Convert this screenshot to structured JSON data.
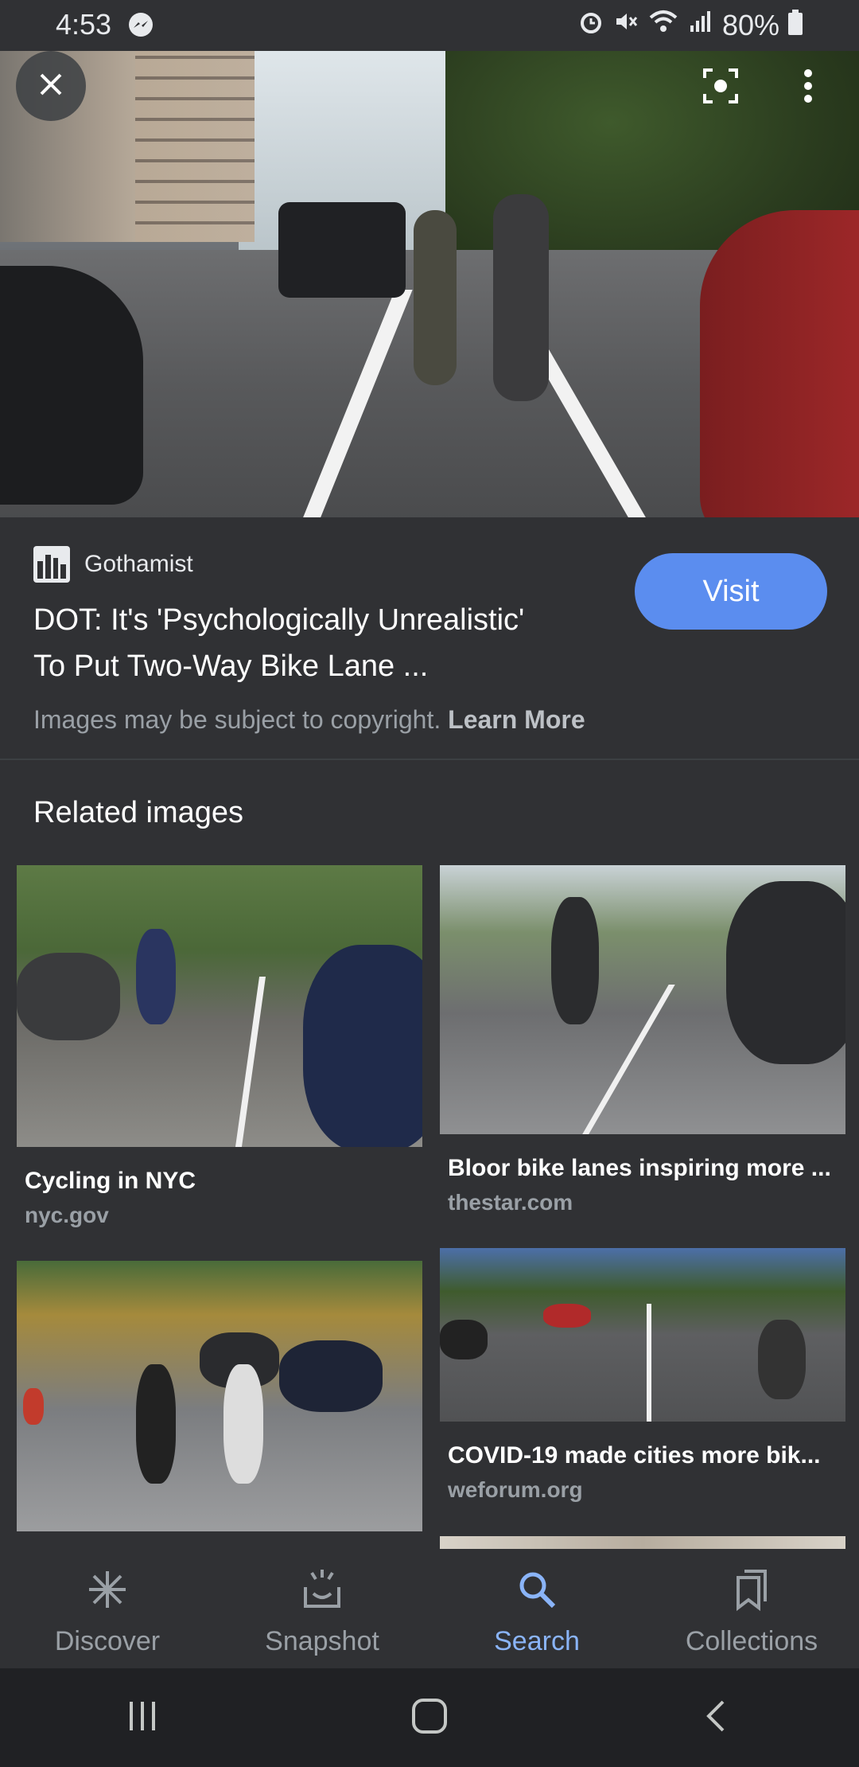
{
  "status_bar": {
    "time": "4:53",
    "battery": "80%",
    "icons": [
      "messenger-icon",
      "alarm-icon",
      "mute-icon",
      "wifi-icon",
      "signal-icon",
      "battery-icon"
    ]
  },
  "hero": {
    "top_buttons": [
      "close-icon",
      "lens-icon",
      "more-vert-icon"
    ]
  },
  "result": {
    "source": "Gothamist",
    "title_line1": "DOT: It's 'Psychologically Unrealistic'",
    "title_line2": "To Put Two-Way Bike Lane ...",
    "visit_label": "Visit",
    "copyright_text": "Images may be subject to copyright.",
    "learn_more": "Learn More"
  },
  "related": {
    "heading": "Related images",
    "items": [
      {
        "title": "Cycling in NYC",
        "source": "nyc.gov"
      },
      {
        "title": "Bloor bike lanes inspiring more ...",
        "source": "thestar.com"
      },
      {
        "title": "",
        "source": ""
      },
      {
        "title": "COVID-19 made cities more bik...",
        "source": "weforum.org"
      }
    ]
  },
  "bottom_nav": {
    "items": [
      {
        "label": "Discover",
        "icon": "asterisk-icon"
      },
      {
        "label": "Snapshot",
        "icon": "snapshot-icon"
      },
      {
        "label": "Search",
        "icon": "search-icon"
      },
      {
        "label": "Collections",
        "icon": "collections-icon"
      }
    ],
    "active": "Search",
    "active_color": "#8ab4f8"
  },
  "system_nav": [
    "recents-icon",
    "home-icon",
    "back-icon"
  ],
  "colors": {
    "background": "#303134",
    "visit_button": "#5b8def",
    "secondary_text": "#9aa0a6"
  }
}
